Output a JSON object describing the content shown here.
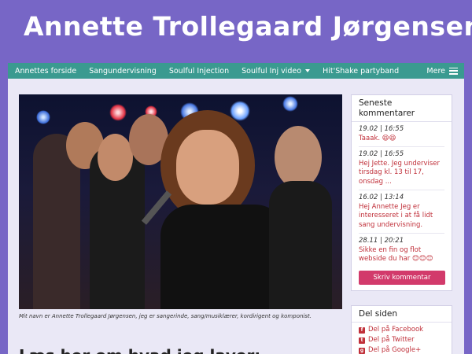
{
  "site": {
    "title": "Annette Trollegaard Jørgensen"
  },
  "nav": {
    "items": [
      {
        "label": "Annettes forside"
      },
      {
        "label": "Sangundervisning"
      },
      {
        "label": "Soulful Injection"
      },
      {
        "label": "Soulful Inj video"
      },
      {
        "label": "Hit'Shake partyband"
      }
    ],
    "more_label": "Mere"
  },
  "main": {
    "caption": "Mit navn er Annette Trollegaard Jørgensen, jeg er sangerinde, sang/musiklærer, kordirigent og komponist.",
    "heading": "Læs her om hvad jeg laver:"
  },
  "comments": {
    "title": "Seneste kommentarer",
    "items": [
      {
        "meta": "19.02 | 16:55",
        "text": "Taaak. 😆😆"
      },
      {
        "meta": "19.02 | 16:55",
        "text": "Hej Jette. Jeg underviser tirsdag kl. 13 til 17, onsdag ..."
      },
      {
        "meta": "16.02 | 13:14",
        "text": "Hej Annette Jeg er interesseret i at få lidt sang undervisning."
      },
      {
        "meta": "28.11 | 20:21",
        "text": "Sikke en fin og flot webside du har 😊😊😊"
      }
    ],
    "button_label": "Skriv kommentar"
  },
  "share": {
    "title": "Del siden",
    "items": [
      {
        "label": "Del på Facebook",
        "icon": "f"
      },
      {
        "label": "Del på Twitter",
        "icon": "t"
      },
      {
        "label": "Del på Google+",
        "icon": "g"
      }
    ]
  },
  "colors": {
    "background": "#7766c6",
    "nav": "#3a9a90",
    "accent": "#d23a6b",
    "link": "#c0303a"
  }
}
